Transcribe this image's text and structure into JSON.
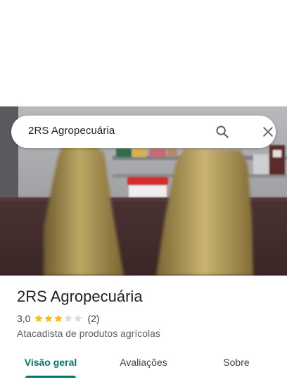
{
  "search": {
    "query": "2RS Agropecuária"
  },
  "place": {
    "name": "2RS Agropecuária",
    "rating": "3,0",
    "rating_stars": 3,
    "rating_max": 5,
    "review_count": "(2)",
    "category": "Atacadista de produtos agrícolas"
  },
  "tabs": [
    {
      "label": "Visão geral",
      "active": true
    },
    {
      "label": "Avaliações",
      "active": false
    },
    {
      "label": "Sobre",
      "active": false
    }
  ],
  "icons": {
    "search": "search-icon",
    "close": "close-icon",
    "star": "star-icon"
  },
  "colors": {
    "accent": "#00796b",
    "star_filled": "#fbbc04",
    "star_empty": "#dadce0"
  }
}
